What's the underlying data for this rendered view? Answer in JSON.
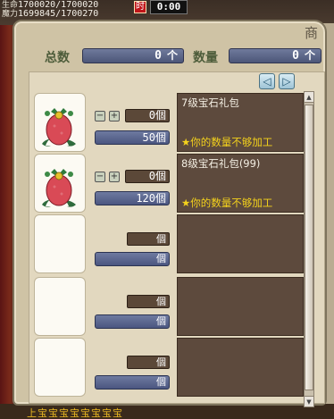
{
  "background": {
    "stat_label_1": "生命",
    "stat_value_1": "1700020/1700020",
    "stat_label_2": "魔力",
    "stat_value_2": "1699845/1700270",
    "red_badge": "时",
    "clock": "0:00",
    "bottom_text": "上宝宝宝宝宝宝宝宝"
  },
  "panel": {
    "title": "商",
    "total_label": "总数",
    "total_value": "0",
    "quantity_label": "数量",
    "quantity_value": "0",
    "sort_arrow": "个"
  },
  "nav": {
    "prev": "◁",
    "next": "▷"
  },
  "items": [
    {
      "name": "7级宝石礼包",
      "qty": "0個",
      "count": "50個",
      "warning": "★你的数量不够加工"
    },
    {
      "name": "8级宝石礼包(99)",
      "qty": "0個",
      "count": "120個",
      "warning": "★你的数量不够加工"
    },
    {
      "qty": "個",
      "count": "個"
    },
    {
      "qty": "個",
      "count": "個"
    },
    {
      "qty": "個",
      "count": "個"
    }
  ],
  "colors": {
    "panel_bg": "#cfc3a5",
    "desc_bg": "#5d4a3d",
    "warning": "#f4d21c",
    "count_field": "#5a6590"
  }
}
